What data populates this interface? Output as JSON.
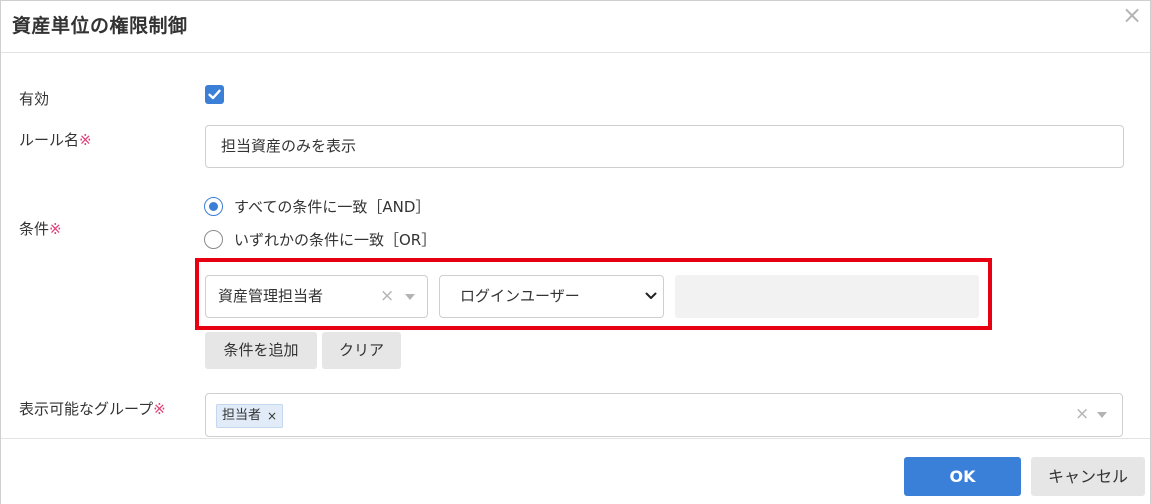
{
  "dialog": {
    "title": "資産単位の権限制御",
    "close_glyph": "×"
  },
  "form": {
    "enabled": {
      "label": "有効",
      "checked": true
    },
    "rule_name": {
      "label": "ルール名",
      "required_mark": "※",
      "value": "担当資産のみを表示"
    },
    "conditions": {
      "label": "条件",
      "required_mark": "※",
      "match_options": [
        {
          "label": "すべての条件に一致［AND］",
          "selected": true
        },
        {
          "label": "いずれかの条件に一致［OR］",
          "selected": false
        }
      ],
      "row": {
        "field_value": "資産管理担当者",
        "field_clear": "×",
        "operator_value": "ログインユーザー",
        "value": ""
      },
      "add_button": "条件を追加",
      "clear_button": "クリア"
    },
    "visible_groups": {
      "label": "表示可能なグループ",
      "required_mark": "※",
      "tags": [
        {
          "label": "担当者",
          "remove": "×"
        }
      ],
      "clear": "×"
    }
  },
  "footer": {
    "ok_label": "OK",
    "cancel_label": "キャンセル"
  },
  "colors": {
    "accent": "#3c7fd6",
    "highlight": "#e60012",
    "required": "#e0407a"
  }
}
